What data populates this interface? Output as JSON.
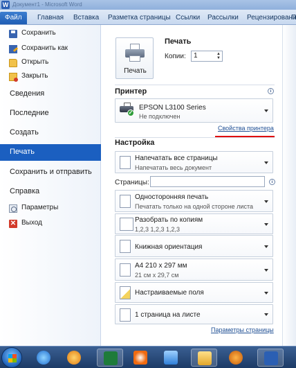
{
  "window": {
    "app_icon": "W",
    "title": "Документ1 - Microsoft Word"
  },
  "tabs": [
    {
      "label": "Файл",
      "active": true
    },
    {
      "label": "Главная"
    },
    {
      "label": "Вставка"
    },
    {
      "label": "Разметка страницы"
    },
    {
      "label": "Ссылки"
    },
    {
      "label": "Рассылки"
    },
    {
      "label": "Рецензирование"
    },
    {
      "label": "П"
    }
  ],
  "backstage": {
    "commands_top": [
      {
        "label": "Сохранить",
        "icon": "save-icon"
      },
      {
        "label": "Сохранить как",
        "icon": "save-as-icon"
      },
      {
        "label": "Открыть",
        "icon": "open-folder-icon"
      },
      {
        "label": "Закрыть",
        "icon": "close-document-icon"
      }
    ],
    "nav": [
      {
        "label": "Сведения"
      },
      {
        "label": "Последние"
      },
      {
        "label": "Создать"
      },
      {
        "label": "Печать",
        "active": true
      },
      {
        "label": "Сохранить и отправить"
      },
      {
        "label": "Справка"
      }
    ],
    "commands_bottom": [
      {
        "label": "Параметры",
        "icon": "options-icon"
      },
      {
        "label": "Выход",
        "icon": "exit-icon"
      }
    ]
  },
  "print": {
    "heading": "Печать",
    "button_label": "Печать",
    "copies_label": "Копии:",
    "copies_value": "1",
    "printer_heading": "Принтер",
    "printer_name": "EPSON L3100 Series",
    "printer_status": "Не подключен",
    "printer_properties_link": "Свойства принтера",
    "settings_heading": "Настройка",
    "pages_label": "Страницы:",
    "pages_value": "",
    "settings": [
      {
        "line1": "Напечатать все страницы",
        "line2": "Напечатать весь документ"
      },
      {
        "line1": "Односторонняя печать",
        "line2": "Печатать только на одной стороне листа"
      },
      {
        "line1": "Разобрать по копиям",
        "line2": "1,2,3    1,2,3    1,2,3"
      },
      {
        "line1": "Книжная ориентация",
        "line2": ""
      },
      {
        "line1": "A4 210 x 297 мм",
        "line2": "21 см x 29,7 см"
      },
      {
        "line1": "Настраиваемые поля",
        "line2": ""
      },
      {
        "line1": "1 страница на листе",
        "line2": ""
      }
    ],
    "page_setup_link": "Параметры страницы"
  },
  "colors": {
    "accent": "#1b5fc0",
    "highlight_underline": "#e00000"
  },
  "taskbar": {
    "items": [
      "start-orb",
      "ie-icon",
      "media-player-icon",
      "excel-icon",
      "media-center-icon",
      "explorer-folder-icon",
      "folder-icon",
      "fox-app-icon",
      "word-icon"
    ]
  }
}
